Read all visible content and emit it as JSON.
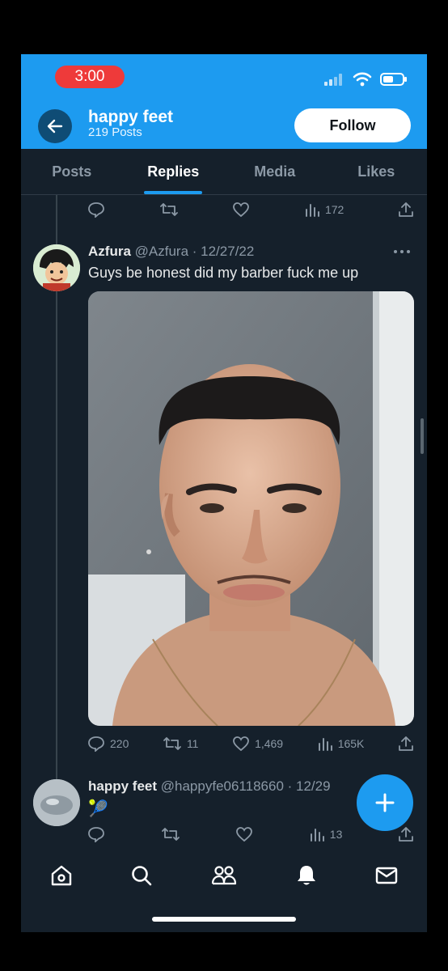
{
  "status": {
    "time": "3:00"
  },
  "header": {
    "title": "happy feet",
    "posts_count": "219 Posts",
    "follow_label": "Follow"
  },
  "tabs": [
    {
      "label": "Posts",
      "active": false
    },
    {
      "label": "Replies",
      "active": true
    },
    {
      "label": "Media",
      "active": false
    },
    {
      "label": "Likes",
      "active": false
    }
  ],
  "prev_tweet": {
    "views": "172"
  },
  "tweet": {
    "author": "Azfura",
    "handle": "@Azfura",
    "date": "· 12/27/22",
    "text": "Guys be honest did my barber fuck me up",
    "replies": "220",
    "retweets": "11",
    "likes": "1,469",
    "views": "165K"
  },
  "reply": {
    "author": "happy feet",
    "handle": "@happyfe06118660",
    "date": "· 12/29",
    "emoji": "🎾",
    "views": "13"
  },
  "colors": {
    "accent": "#1d9bf0",
    "background": "#15202b",
    "time_pill": "#ee3a3a"
  }
}
